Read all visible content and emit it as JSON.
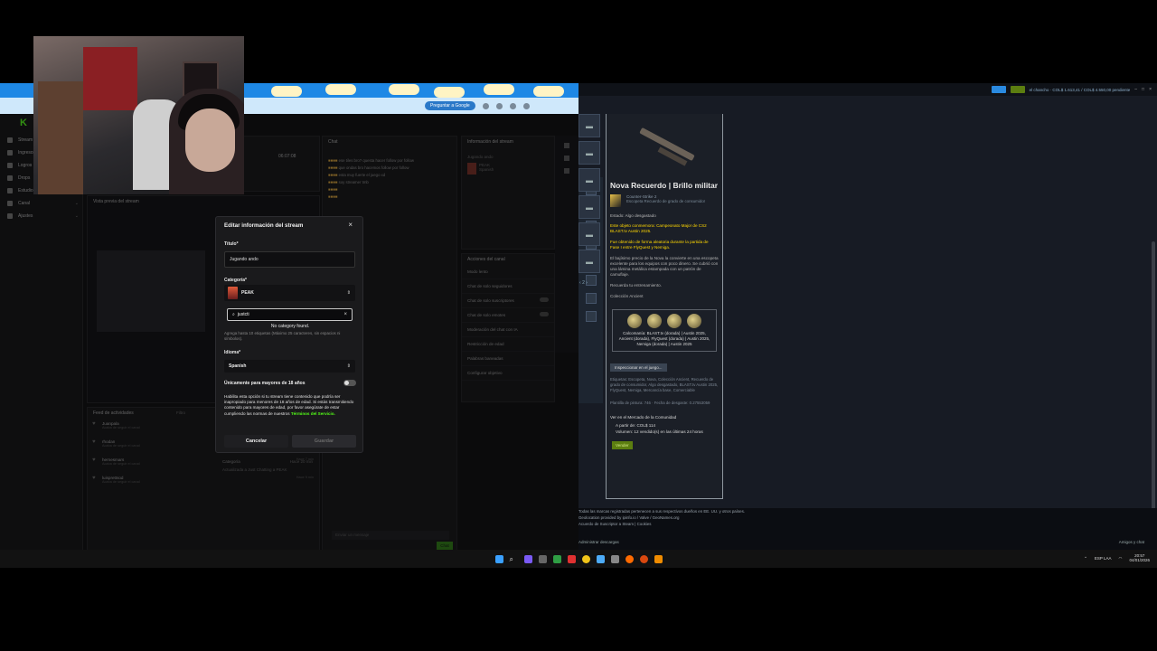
{
  "modal": {
    "title": "Editar información del stream",
    "title_label": "Título*",
    "title_value": "Jugando ando",
    "category_label": "Categoría*",
    "category_value": "PEAK",
    "search_value": "justcti",
    "no_category": "No category found.",
    "tags_note": "Agrega hasta 10 etiquetas (Máximo 25 caracteres, sin espacios ni símbolos).",
    "language_label": "Idioma*",
    "language_value": "Spanish",
    "adult_label": "Únicamente para mayores de 18 años",
    "adult_desc": "Habilita esta opción si tu stream tiene contenido que podría ser inapropiado para menores de 18 años de edad. Si estás transmitiendo contenido para mayores de edad, por favor asegúrate de estar cumpliendo las normas de nuestros",
    "terms_link": "Términos del Servicio.",
    "cancel": "Cancelar",
    "save": "Guardar"
  },
  "dashboard": {
    "nav": [
      "Stream",
      "Ingresos",
      "Logros",
      "Drops",
      "Estudio",
      "Canal",
      "Ajustes"
    ],
    "timer": "06:07:08",
    "preview_label": "Vista previa del stream",
    "chat_title": "Chat",
    "chat_lines": [
      {
        "user": "",
        "text": "ese tiles bro? questa hacer follow por follow"
      },
      {
        "user": "",
        "text": "que ondas bro hacemos follow por follow"
      },
      {
        "user": "",
        "text": "esta muy fuerte el juego xd"
      },
      {
        "user": "",
        "text": "soy streamer tmb"
      },
      {
        "user": "",
        "text": ""
      },
      {
        "user": "",
        "text": ""
      }
    ],
    "stream_info_title": "Información del stream",
    "playing_now": "Jugando ando",
    "playing_game": "PEAK",
    "playing_tag": "Spanish",
    "channel_actions_title": "Acciones del canal",
    "channel_actions": [
      "Modo lento",
      "Chat de solo seguidores",
      "Chat de solo suscriptores",
      "Chat de solo emotes",
      "Moderación del chat con IA",
      "Restricción de edad",
      "Palabras baneadas",
      "Configurar objetivo"
    ],
    "activity_title": "Feed de actividades",
    "activity_filter": "Filtro",
    "activity": [
      {
        "name": "Juanpala",
        "sub": "Acaba de seguir el canal",
        "time": "Hace 2 minutos"
      },
      {
        "name": "rhodan",
        "sub": "Acaba de seguir el canal",
        "time": "Hace 6 min"
      },
      {
        "name": "hernesmars",
        "sub": "Acaba de seguir el canal",
        "time": "Hace 7 min"
      },
      {
        "name": "luisprettsod",
        "sub": "Acaba de seguir el canal",
        "time": "Hace 9 min"
      }
    ],
    "category_title": "Categoría",
    "category_note": "Actualizada a Just Chatting a PEAK",
    "category_time": "Hace 20 min",
    "chat_send": "Chat",
    "chat_placeholder": "Enviar un mensaje"
  },
  "browser": {
    "pill": "Preguntar a Google"
  },
  "steam": {
    "account": "el chancho · COL$ 1.613,41 / COL$ 4.550,00 pendiente",
    "item_name": "Nova Recuerdo | Brillo militar",
    "game": "Counter-Strike 2",
    "item_type": "Escopeta Recuerdo de grado de consumidor",
    "wear": "Estado: Algo desgastado",
    "commemorates": "Este objeto conmemora: Campeonato Major de CS2 BLAST.tv Austin 2025.",
    "obtained": "Fue obtenido de forma aleatoria durante la partida de Fase I entre FlyQuest y Nemiga.",
    "description": "El bajísimo precio de la Nova la convierte en una escopeta excelente para los equipos con poco dinero. Se cubrió con una lámina metálica estampada con un patrón de camuflaje.",
    "quote": "Recuerda tu entrenamiento.",
    "collection": "Colección Ancient",
    "stickers_caption": "Calcomanía: BLAST.tv (dorada) | Austin 2025, Ancient (dorada), FlyQuest (dorada) | Austin 2025, Nemiga (dorada) | Austin 2025",
    "inspect": "Inspeccionar en el juego...",
    "tags": "Etiquetas: Escopeta, Nova, Colección Ancient, Recuerdo de grado de consumidor, Algo desgastado, BLAST.tv Austin 2025, FlyQuest, Nemiga, Mercancía base, Comerciable",
    "trade_note": "Plantilla de pintura: 746 · Fecha de desgaste: 0.27553059",
    "market_title": "Ver en el Mercado de la Comunidad",
    "price_from": "A partir de: COL$ 114",
    "volume": "Volumen: 12 vendido(s) en las últimas 24 horas",
    "sell": "Vender",
    "pager": "2",
    "footer_lines": [
      "Todas las marcas registradas pertenecen a sus respectivos dueños en EE. UU. y otros países.",
      "Geolocation provided by ipinfo.io / Valve / GeoNames.org",
      "Acuerdo de Suscriptor a Steam | Cookies"
    ],
    "downloads": "Administrar descargas",
    "friends": "Amigos y chat"
  },
  "taskbar": {
    "lang": "ESP LAA",
    "time": "20:57",
    "date": "04/01/2026"
  }
}
